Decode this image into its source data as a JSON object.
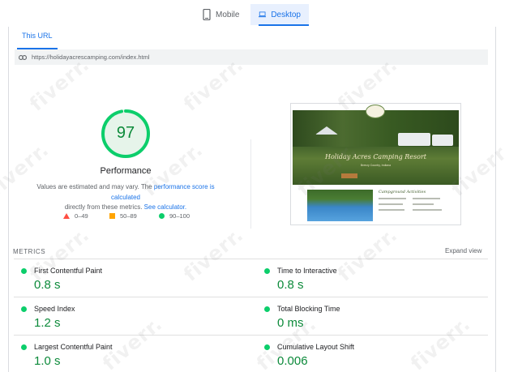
{
  "device_tabs": [
    {
      "label": "Mobile",
      "icon": "smartphone-icon",
      "active": false
    },
    {
      "label": "Desktop",
      "icon": "laptop-icon",
      "active": true
    }
  ],
  "url_tab": {
    "label": "This URL"
  },
  "url_bar": {
    "icon": "link-icon",
    "url": "https://holidayacrescamping.com/index.html"
  },
  "score": {
    "value": "97",
    "fraction": 0.97,
    "label": "Performance",
    "color": "#0cce6b",
    "description": {
      "part1": "Values are estimated and may vary. The ",
      "link1": "performance score is calculated",
      "part2": " directly from these metrics. ",
      "link2": "See calculator."
    }
  },
  "legend": [
    {
      "range": "0–49",
      "shape": "triangle",
      "color": "#ff4e42"
    },
    {
      "range": "50–89",
      "shape": "square",
      "color": "#ffa400"
    },
    {
      "range": "90–100",
      "shape": "circle",
      "color": "#0cce6b"
    }
  ],
  "thumbnail": {
    "site_title": "Holiday Acres Camping Resort",
    "site_subtitle": "Breezy Country, Indiana",
    "section_heading": "Campground Activities"
  },
  "metrics": {
    "title": "METRICS",
    "expand_label": "Expand view",
    "items": [
      {
        "name": "First Contentful Paint",
        "value": "0.8 s",
        "status": "good"
      },
      {
        "name": "Time to Interactive",
        "value": "0.8 s",
        "status": "good"
      },
      {
        "name": "Speed Index",
        "value": "1.2 s",
        "status": "good"
      },
      {
        "name": "Total Blocking Time",
        "value": "0 ms",
        "status": "good"
      },
      {
        "name": "Largest Contentful Paint",
        "value": "1.0 s",
        "status": "good"
      },
      {
        "name": "Cumulative Layout Shift",
        "value": "0.006",
        "status": "good"
      }
    ]
  },
  "watermark": {
    "text": "fiverr."
  }
}
